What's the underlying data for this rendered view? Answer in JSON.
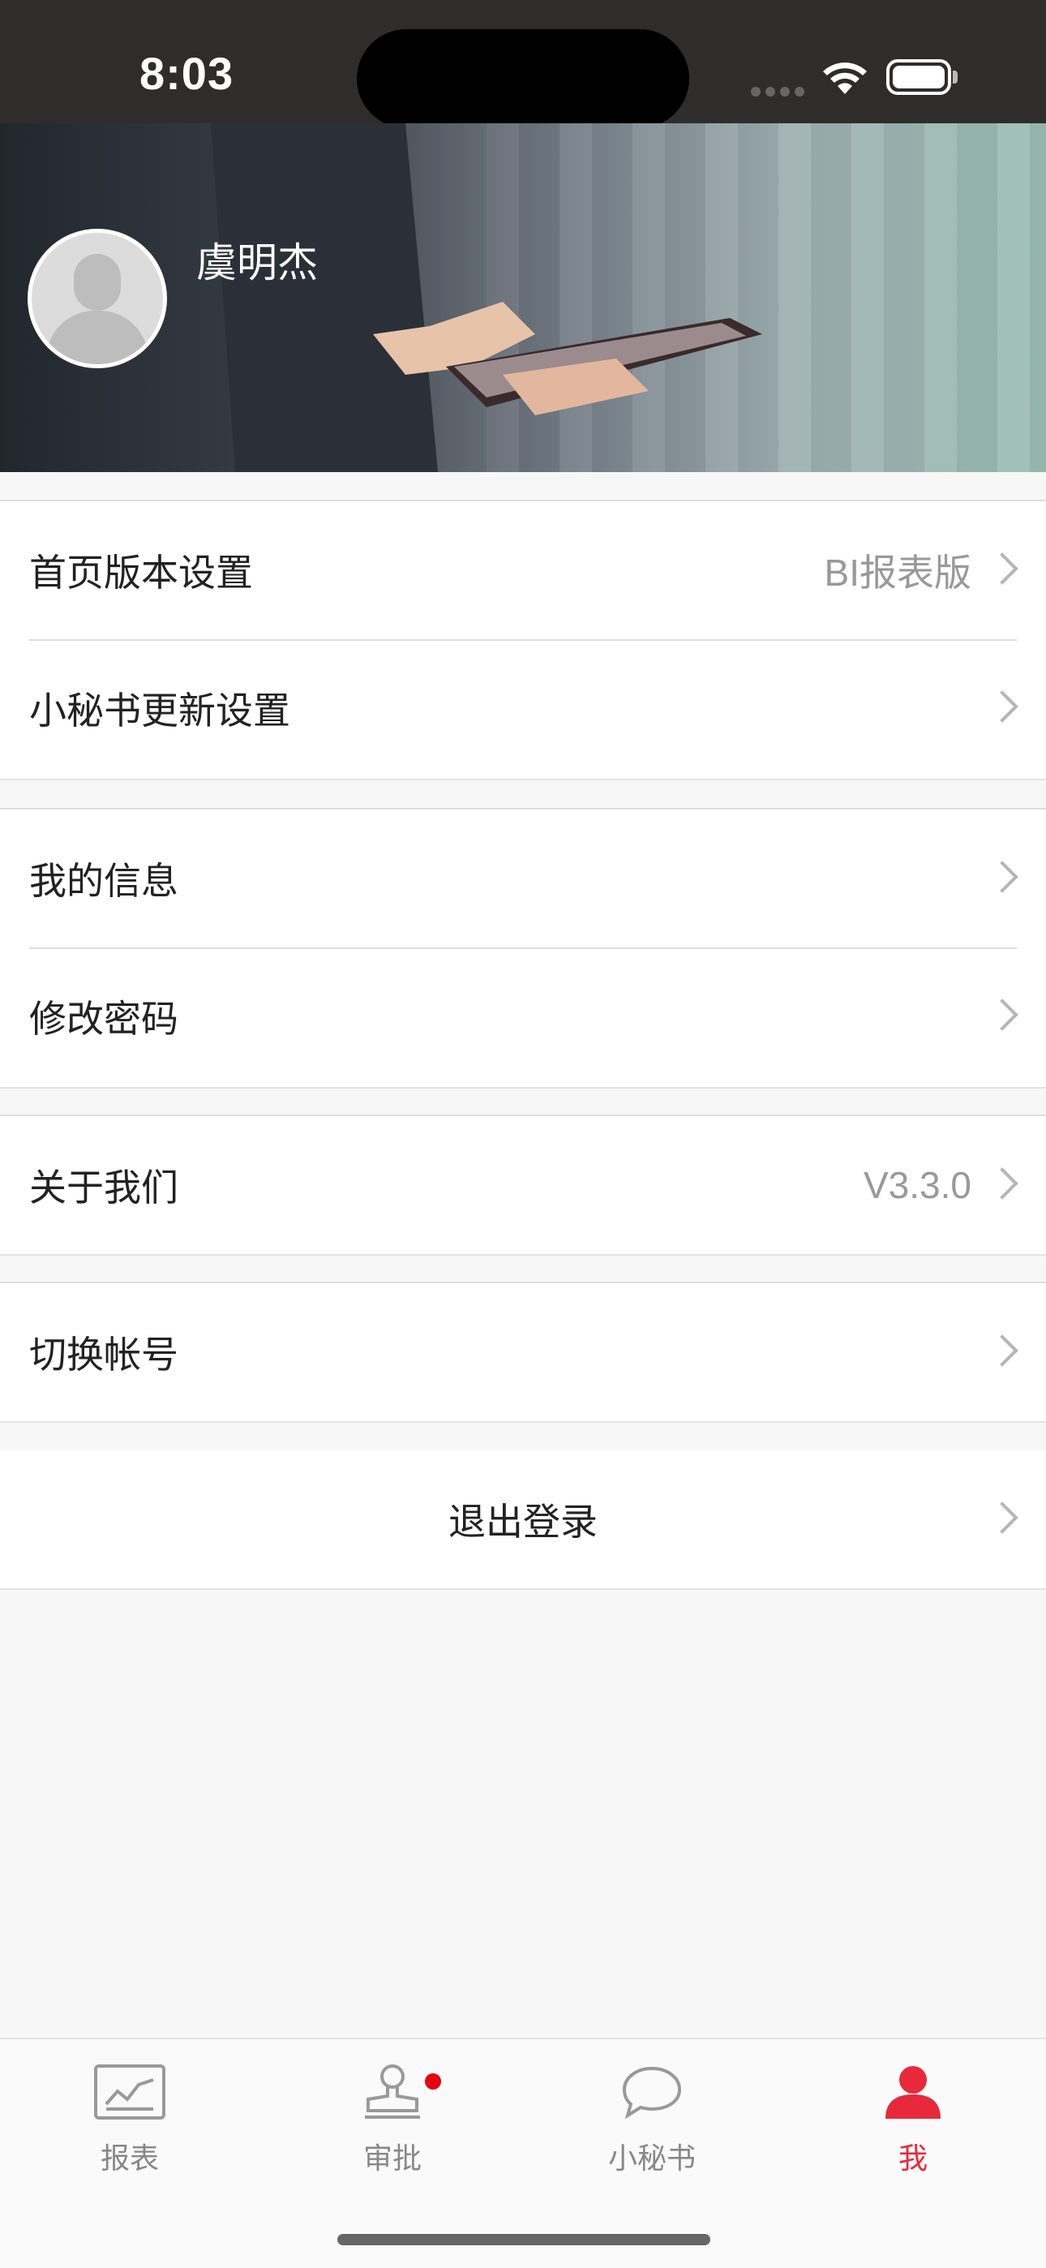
{
  "status": {
    "time": "8:03"
  },
  "profile": {
    "name": "虞明杰"
  },
  "settings": {
    "homepage_version": {
      "label": "首页版本设置",
      "value": "BI报表版"
    },
    "secretary_update": {
      "label": "小秘书更新设置"
    },
    "my_info": {
      "label": "我的信息"
    },
    "change_password": {
      "label": "修改密码"
    },
    "about_us": {
      "label": "关于我们",
      "value": "V3.3.0"
    },
    "switch_account": {
      "label": "切换帐号"
    },
    "logout": {
      "label": "退出登录"
    }
  },
  "tabbar": {
    "tabs": [
      {
        "label": "报表",
        "icon": "chart-icon"
      },
      {
        "label": "审批",
        "icon": "stamp-icon",
        "badge": true
      },
      {
        "label": "小秘书",
        "icon": "chat-bubble-icon"
      },
      {
        "label": "我",
        "icon": "person-icon",
        "active": true
      }
    ]
  },
  "colors": {
    "accent": "#e8293b",
    "badge": "#e60012"
  }
}
